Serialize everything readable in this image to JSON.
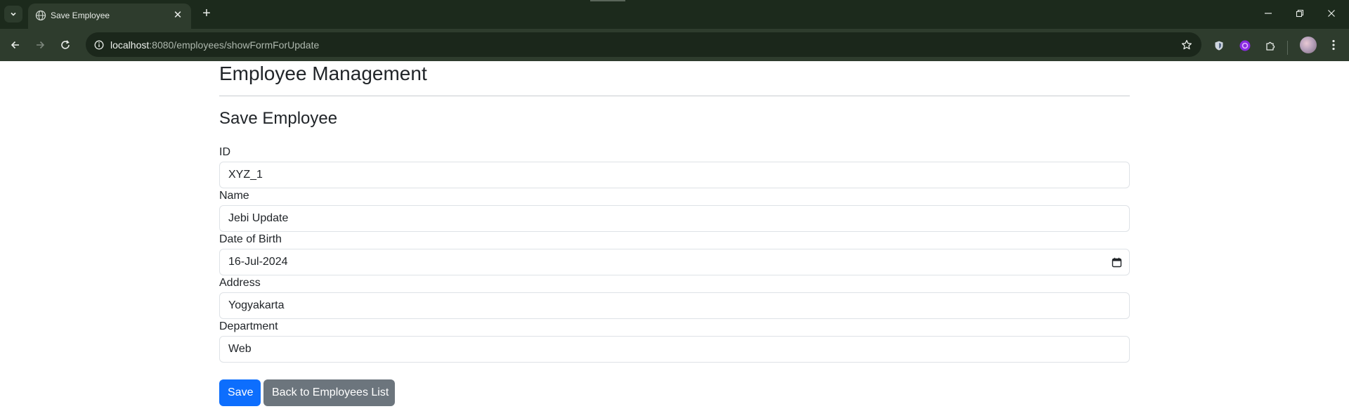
{
  "browser": {
    "tab_title": "Save Employee",
    "url_host": "localhost",
    "url_rest": ":8080/employees/showFormForUpdate",
    "icons": {
      "tab_list": "chevron-down-icon",
      "tab_favicon": "globe-icon",
      "tab_close": "close-icon",
      "new_tab": "plus-icon",
      "minimize": "minimize-icon",
      "restore": "restore-icon",
      "close_window": "close-icon",
      "back": "arrow-left-icon",
      "forward": "arrow-right-icon",
      "reload": "reload-icon",
      "site_info": "info-icon",
      "bookmark": "star-icon",
      "extension_shield": "shield-icon",
      "extension_purple": "extension-icon",
      "extensions": "puzzle-icon",
      "profile": "avatar",
      "menu": "more-vertical-icon"
    }
  },
  "page": {
    "app_title": "Employee Management",
    "form_title": "Save Employee"
  },
  "form": {
    "fields": [
      {
        "label": "ID",
        "value": "XYZ_1"
      },
      {
        "label": "Name",
        "value": "Jebi Update"
      },
      {
        "label": "Date of Birth",
        "value": "16-Jul-2024"
      },
      {
        "label": "Address",
        "value": "Yogyakarta"
      },
      {
        "label": "Department",
        "value": "Web"
      }
    ],
    "save_label": "Save",
    "back_label": "Back to Employees List"
  },
  "colors": {
    "primary_button": "#0d6efd",
    "secondary_button": "#6c757d",
    "browser_frame": "#1c2a1c",
    "browser_toolbar": "#2e3c2d"
  }
}
